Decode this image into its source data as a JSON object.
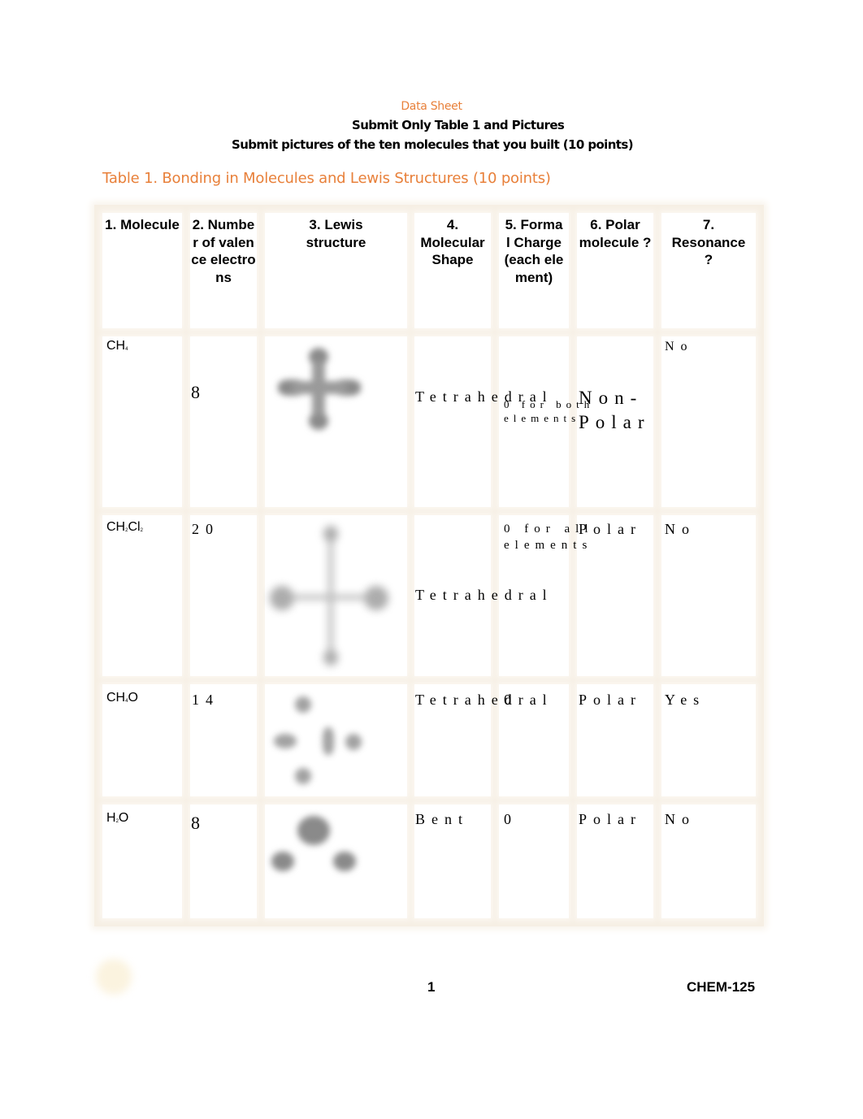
{
  "document": {
    "heading": "Data Sheet",
    "subheading_1": "Submit Only Table 1 and Pictures",
    "subheading_2": "Submit pictures of the ten molecules that you built (10 points)",
    "table_caption": "Table 1. Bonding in Molecules and Lewis Structures (10 points)",
    "accent_color": "#e8803a"
  },
  "table": {
    "headers": [
      "1. Molecule",
      "2. Number of valence electrons",
      "3. Lewis structure",
      "4. Molecular Shape",
      "5. Formal Charge (each element)",
      "6. Polar molecule ?",
      "7. Resonance ?"
    ],
    "rows": [
      {
        "molecule": {
          "base": "CH",
          "sub1": "4",
          "mid": "",
          "sub2": ""
        },
        "valence_electrons": "8",
        "lewis_structure": "blurred-image-methane",
        "shape": "Tetrahedral",
        "formal_charge": "0 for both elements",
        "polar": "Non-Polar",
        "resonance": "No"
      },
      {
        "molecule": {
          "base": "CH",
          "sub1": "2",
          "mid": "Cl",
          "sub2": "2"
        },
        "valence_electrons": "20",
        "lewis_structure": "blurred-image-dichloromethane",
        "shape": "Tetrahedral",
        "formal_charge": "0 for all elements",
        "polar": "Polar",
        "resonance": "No"
      },
      {
        "molecule": {
          "base": "CH",
          "sub1": "4",
          "mid": "O",
          "sub2": ""
        },
        "valence_electrons": "14",
        "lewis_structure": "blurred-image-methanol",
        "shape": "Tetrahedral",
        "formal_charge": "0",
        "polar": "Polar",
        "resonance": "Yes"
      },
      {
        "molecule": {
          "base": "H",
          "sub1": "2",
          "mid": "O",
          "sub2": ""
        },
        "valence_electrons": "8",
        "lewis_structure": "blurred-image-water",
        "shape": "Bent",
        "formal_charge": "0",
        "polar": "Polar",
        "resonance": "No"
      }
    ]
  },
  "footer": {
    "page_number": "1",
    "course_code": "CHEM-125"
  }
}
